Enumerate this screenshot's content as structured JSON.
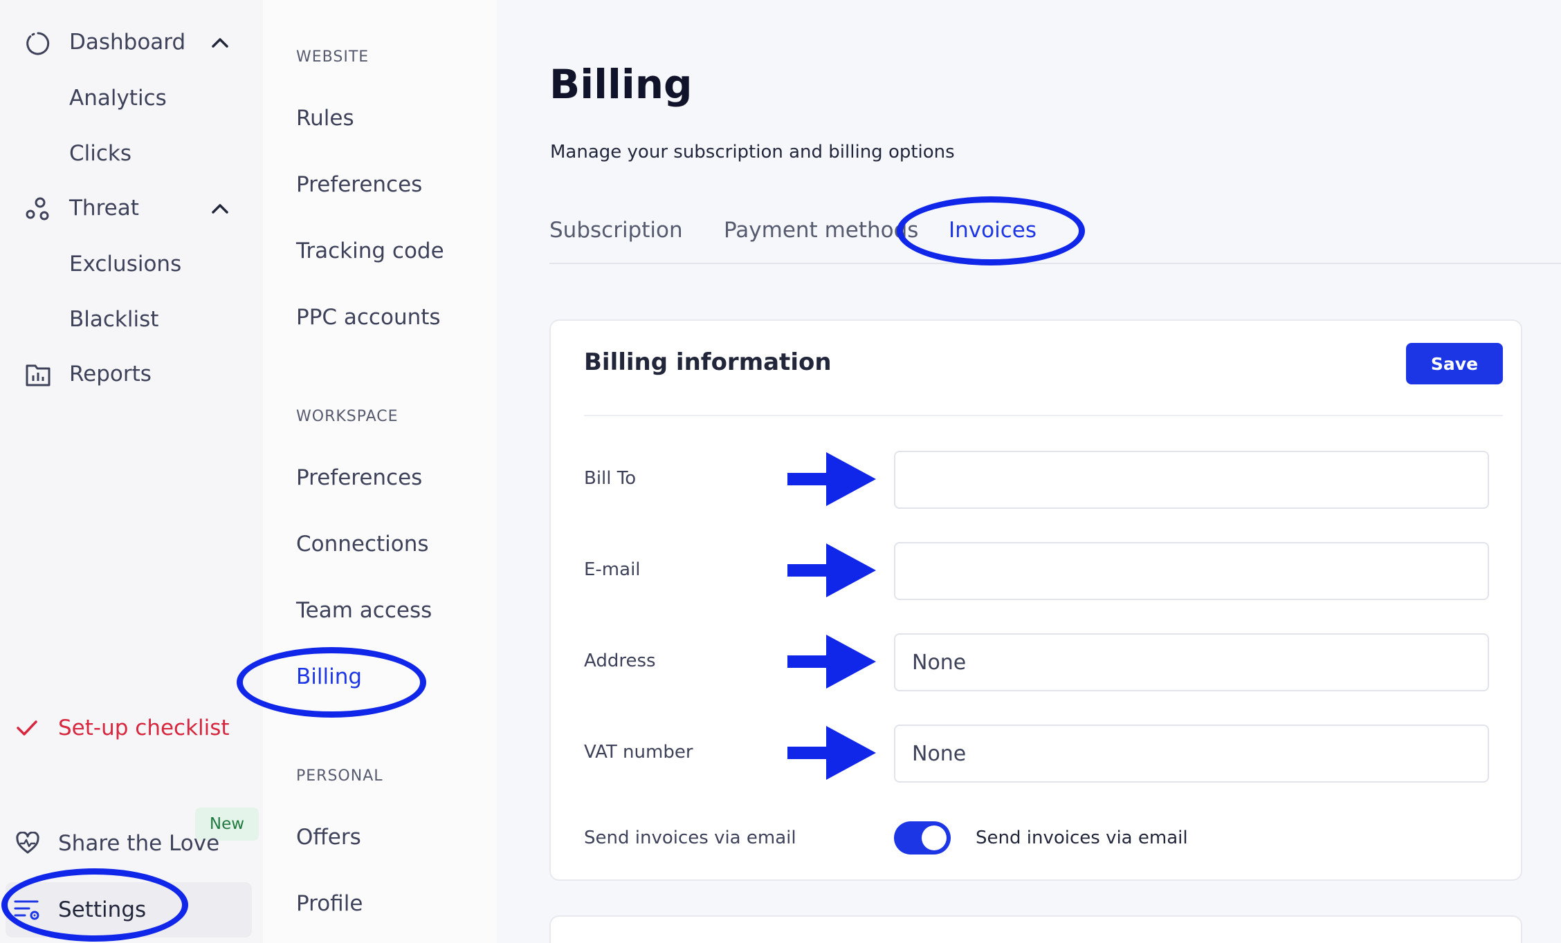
{
  "sidebar": {
    "dashboard": "Dashboard",
    "analytics": "Analytics",
    "clicks": "Clicks",
    "threat": "Threat",
    "exclusions": "Exclusions",
    "blacklist": "Blacklist",
    "reports": "Reports",
    "setup_checklist": "Set-up checklist",
    "share_the_love": "Share the Love",
    "new_badge": "New",
    "settings": "Settings"
  },
  "submenu": {
    "website_label": "WEBSITE",
    "rules": "Rules",
    "preferences": "Preferences",
    "tracking_code": "Tracking code",
    "ppc_accounts": "PPC accounts",
    "workspace_label": "WORKSPACE",
    "ws_preferences": "Preferences",
    "connections": "Connections",
    "team_access": "Team access",
    "billing": "Billing",
    "personal_label": "PERSONAL",
    "offers": "Offers",
    "profile": "Profile"
  },
  "main": {
    "title": "Billing",
    "subtitle": "Manage your subscription and billing options",
    "tabs": [
      "Subscription",
      "Payment methods",
      "Invoices"
    ],
    "active_tab": "Invoices"
  },
  "billing_info": {
    "title": "Billing information",
    "save_label": "Save",
    "fields": {
      "bill_to": {
        "label": "Bill To",
        "value": ""
      },
      "email": {
        "label": "E-mail",
        "value": ""
      },
      "address": {
        "label": "Address",
        "value": "None"
      },
      "vat": {
        "label": "VAT number",
        "value": "None"
      }
    },
    "send_invoices_label": "Send invoices via email",
    "send_invoices_toggle_label": "Send invoices via email",
    "send_invoices_enabled": true
  },
  "colors": {
    "accent": "#1c36e6",
    "annotation": "#1026e8",
    "checklist": "#d7263d"
  }
}
